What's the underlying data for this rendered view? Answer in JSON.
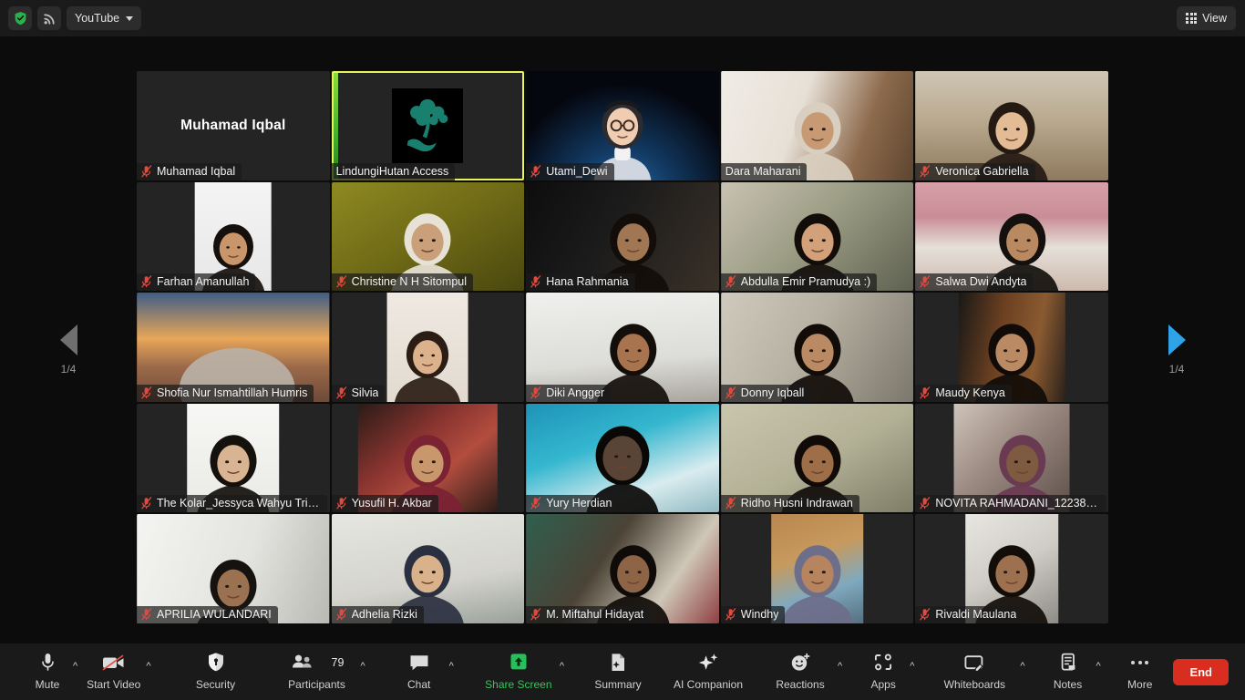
{
  "topbar": {
    "shield_icon": "security-shield-icon",
    "record_icon": "broadcast-icon",
    "source_label": "YouTube",
    "view_label": "View"
  },
  "pager": {
    "left_label": "1/4",
    "right_label": "1/4"
  },
  "gallery": {
    "tiles": [
      {
        "name": "Muhamad Iqbal",
        "muted": true,
        "self": true,
        "active": false,
        "kind": "name-only"
      },
      {
        "name": "LindungiHutan Access",
        "muted": false,
        "self": false,
        "active": true,
        "kind": "logo"
      },
      {
        "name": "Utami_Dewi",
        "muted": true,
        "self": false,
        "active": false,
        "kind": "video"
      },
      {
        "name": "Dara Maharani",
        "muted": false,
        "self": false,
        "active": false,
        "kind": "video"
      },
      {
        "name": "Veronica Gabriella",
        "muted": true,
        "self": false,
        "active": false,
        "kind": "video"
      },
      {
        "name": "Farhan Amanullah",
        "muted": true,
        "self": false,
        "active": false,
        "kind": "video"
      },
      {
        "name": "Christine N H Sitompul",
        "muted": true,
        "self": false,
        "active": false,
        "kind": "video"
      },
      {
        "name": "Hana Rahmania",
        "muted": true,
        "self": false,
        "active": false,
        "kind": "video"
      },
      {
        "name": "Abdulla Emir Pramudya :)",
        "muted": true,
        "self": false,
        "active": false,
        "kind": "video"
      },
      {
        "name": "Salwa Dwi Andyta",
        "muted": true,
        "self": false,
        "active": false,
        "kind": "video"
      },
      {
        "name": "Shofia Nur Ismahtillah Humris",
        "muted": true,
        "self": false,
        "active": false,
        "kind": "video"
      },
      {
        "name": "Silvia",
        "muted": true,
        "self": false,
        "active": false,
        "kind": "video"
      },
      {
        "name": "Diki Angger",
        "muted": true,
        "self": false,
        "active": false,
        "kind": "video"
      },
      {
        "name": "Donny Iqball",
        "muted": true,
        "self": false,
        "active": false,
        "kind": "video"
      },
      {
        "name": "Maudy Kenya",
        "muted": true,
        "self": false,
        "active": false,
        "kind": "video"
      },
      {
        "name": "The Kolar_Jessyca Wahyu Tria...",
        "muted": true,
        "self": false,
        "active": false,
        "kind": "video"
      },
      {
        "name": "Yusufil H. Akbar",
        "muted": true,
        "self": false,
        "active": false,
        "kind": "video"
      },
      {
        "name": "Yury Herdian",
        "muted": true,
        "self": false,
        "active": false,
        "kind": "video"
      },
      {
        "name": "Ridho Husni Indrawan",
        "muted": true,
        "self": false,
        "active": false,
        "kind": "video"
      },
      {
        "name": "NOVITA RAHMADANI_122380...",
        "muted": true,
        "self": false,
        "active": false,
        "kind": "video"
      },
      {
        "name": "APRILIA WULANDARI",
        "muted": true,
        "self": false,
        "active": false,
        "kind": "video"
      },
      {
        "name": "Adhelia Rizki",
        "muted": true,
        "self": false,
        "active": false,
        "kind": "video"
      },
      {
        "name": "M. Miftahul Hidayat",
        "muted": true,
        "self": false,
        "active": false,
        "kind": "video"
      },
      {
        "name": "Windhy",
        "muted": true,
        "self": false,
        "active": false,
        "kind": "video"
      },
      {
        "name": "Rivaldi Maulana",
        "muted": true,
        "self": false,
        "active": false,
        "kind": "video"
      }
    ]
  },
  "toolbar": {
    "mute_label": "Mute",
    "video_label": "Start Video",
    "security_label": "Security",
    "participants_label": "Participants",
    "participants_count": "79",
    "chat_label": "Chat",
    "share_label": "Share Screen",
    "summary_label": "Summary",
    "ai_label": "AI Companion",
    "reactions_label": "Reactions",
    "apps_label": "Apps",
    "whiteboards_label": "Whiteboards",
    "notes_label": "Notes",
    "more_label": "More",
    "end_label": "End"
  },
  "colors": {
    "accent_green": "#37c45a",
    "end_red": "#d92d20",
    "active_speaker_border": "#e8f25a",
    "pager_active": "#2fa3e8",
    "mute_red": "#e04a3f"
  }
}
